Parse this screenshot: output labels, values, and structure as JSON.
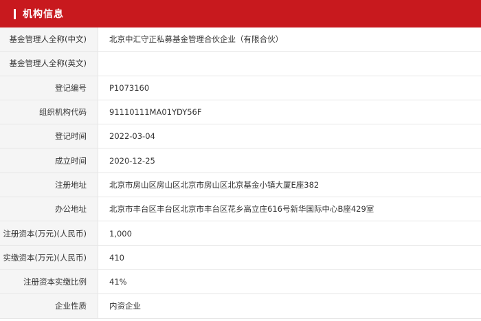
{
  "section": {
    "title": "机构信息",
    "accent_color": "#c8191e"
  },
  "rows": [
    {
      "label": "基金管理人全称(中文)",
      "value": "北京中汇守正私募基金管理合伙企业（有限合伙）"
    },
    {
      "label": "基金管理人全称(英文)",
      "value": ""
    },
    {
      "label": "登记编号",
      "value": "P1073160"
    },
    {
      "label": "组织机构代码",
      "value": "91110111MA01YDY56F"
    },
    {
      "label": "登记时间",
      "value": "2022-03-04"
    },
    {
      "label": "成立时间",
      "value": "2020-12-25"
    },
    {
      "label": "注册地址",
      "value": "北京市房山区房山区北京市房山区北京基金小镇大厦E座382"
    },
    {
      "label": "办公地址",
      "value": "北京市丰台区丰台区北京市丰台区花乡高立庄616号新华国际中心B座429室"
    },
    {
      "label": "注册资本(万元)(人民币)",
      "value": "1,000"
    },
    {
      "label": "实缴资本(万元)(人民币)",
      "value": "410"
    },
    {
      "label": "注册资本实缴比例",
      "value": "41%"
    },
    {
      "label": "企业性质",
      "value": "内资企业"
    }
  ]
}
